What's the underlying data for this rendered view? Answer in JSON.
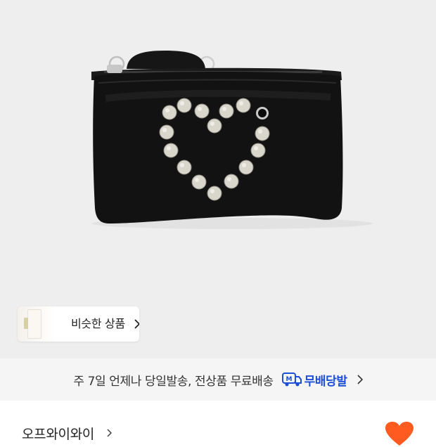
{
  "similar_products": {
    "label": "비슷한 상품"
  },
  "shipping_banner": {
    "text": "주 7일 언제나 당일발송, 전상품 무료배송",
    "badge_label": "무배당발",
    "badge_icon_letter": "M",
    "accent_color": "#1d4ed8"
  },
  "seller": {
    "name": "오프와이와이"
  },
  "like": {
    "color": "#ff5a1f",
    "icon": "heart-icon"
  }
}
